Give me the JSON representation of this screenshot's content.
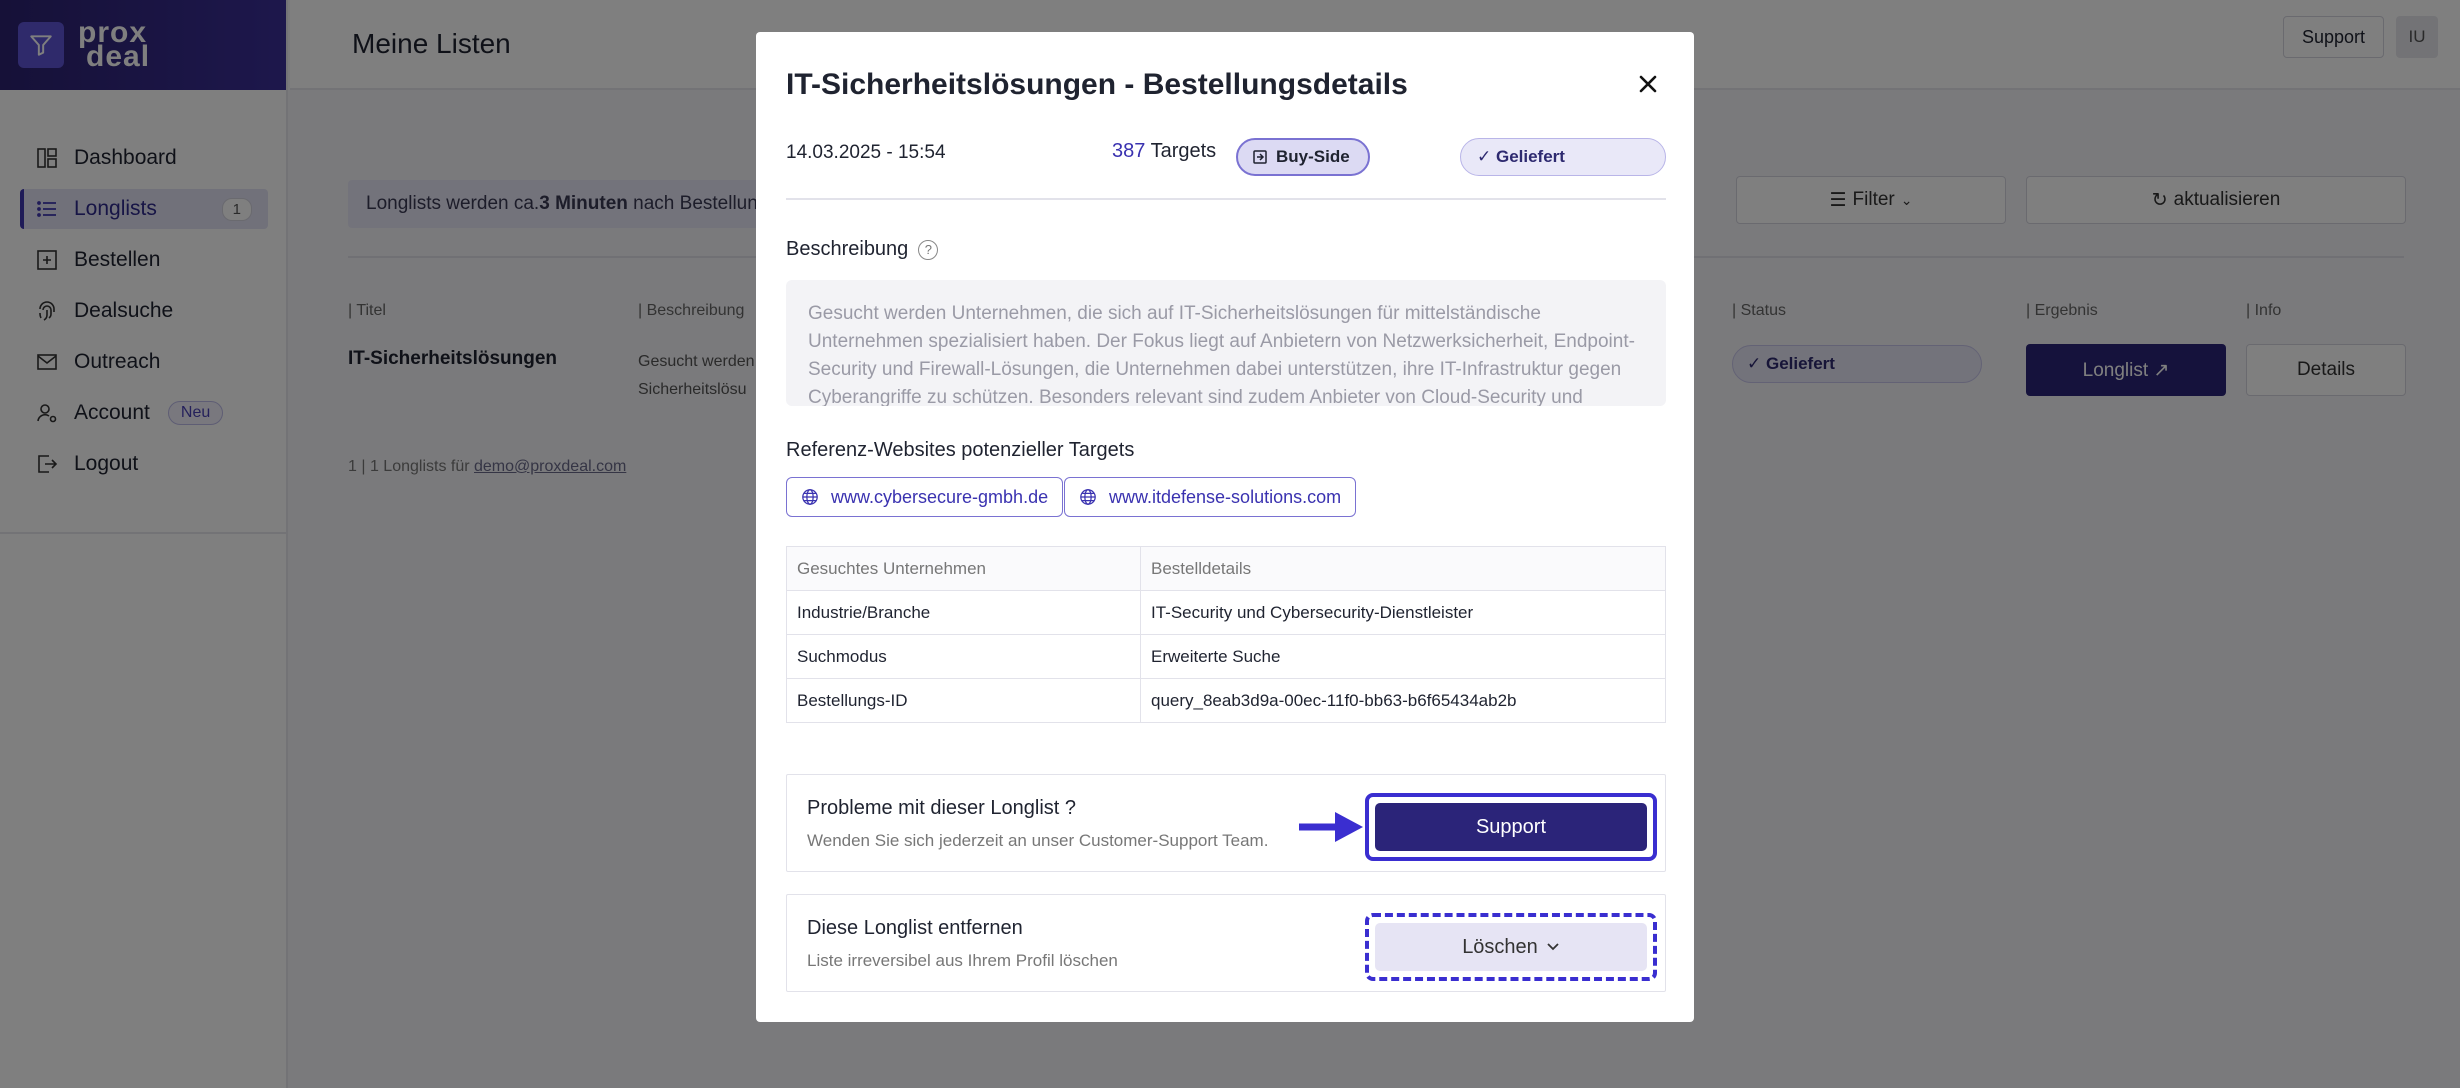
{
  "app": {
    "logo_line1": "prox",
    "logo_line2": "deal",
    "page_title": "Meine Listen",
    "top_support": "Support",
    "avatar_initials": "IU"
  },
  "sidebar": {
    "items": [
      {
        "label": "Dashboard",
        "icon": "dashboard-icon"
      },
      {
        "label": "Longlists",
        "icon": "list-icon",
        "badge": "1",
        "active": true
      },
      {
        "label": "Bestellen",
        "icon": "plus-square-icon"
      },
      {
        "label": "Dealsuche",
        "icon": "fingerprint-icon"
      },
      {
        "label": "Outreach",
        "icon": "mail-icon"
      },
      {
        "label": "Account",
        "icon": "user-settings-icon",
        "tag": "Neu"
      },
      {
        "label": "Logout",
        "icon": "logout-icon"
      }
    ]
  },
  "background": {
    "info_prefix": "Longlists werden ca. ",
    "info_bold": "3 Minuten",
    "info_suffix": " nach Bestellung",
    "filter_label": "Filter",
    "refresh_label": "aktualisieren",
    "headers": {
      "titel": "| Titel",
      "beschreibung": "| Beschreibung",
      "status": "| Status",
      "ergebnis": "| Ergebnis",
      "info": "| Info"
    },
    "row": {
      "title": "IT-Sicherheitslösungen",
      "desc_line1": "Gesucht werden",
      "desc_line2": "Sicherheitslösu",
      "status": "✓ Geliefert",
      "longlist_btn": "Longlist ↗",
      "details_btn": "Details"
    },
    "footer_prefix": "1 | 1 Longlists für ",
    "footer_email": "demo@proxdeal.com"
  },
  "modal": {
    "title": "IT-Sicherheitslösungen - Bestellungsdetails",
    "close": "×",
    "date": "14.03.2025 - 15:54",
    "targets_count": "387",
    "targets_label": " Targets",
    "buyside": "Buy-Side",
    "status": "✓ Geliefert",
    "desc_label": "Beschreibung",
    "description": "Gesucht werden Unternehmen, die sich auf IT-Sicherheitslösungen für mittelständische Unternehmen spezialisiert haben. Der Fokus liegt auf Anbietern von Netzwerksicherheit, Endpoint-Security und Firewall-Lösungen, die Unternehmen dabei unterstützen, ihre IT-Infrastruktur gegen Cyberangriffe zu schützen. Besonders relevant sind zudem Anbieter von Cloud-Security und",
    "ref_label": "Referenz-Websites potenzieller Targets",
    "links": [
      "www.cybersecure-gmbh.de",
      "www.itdefense-solutions.com"
    ],
    "table": {
      "headers": [
        "Gesuchtes Unternehmen",
        "Bestelldetails"
      ],
      "rows": [
        [
          "Industrie/Branche",
          "IT-Security und Cybersecurity-Dienstleister"
        ],
        [
          "Suchmodus",
          "Erweiterte Suche"
        ],
        [
          "Bestellungs-ID",
          "query_8eab3d9a-00ec-11f0-bb63-b6f65434ab2b"
        ]
      ]
    },
    "support_card": {
      "title": "Probleme mit dieser Longlist ?",
      "subtitle": "Wenden Sie sich jederzeit an unser Customer-Support Team.",
      "button": "Support"
    },
    "delete_card": {
      "title": "Diese Longlist entfernen",
      "subtitle": "Liste irreversibel aus Ihrem Profil löschen",
      "button": "Löschen"
    }
  }
}
